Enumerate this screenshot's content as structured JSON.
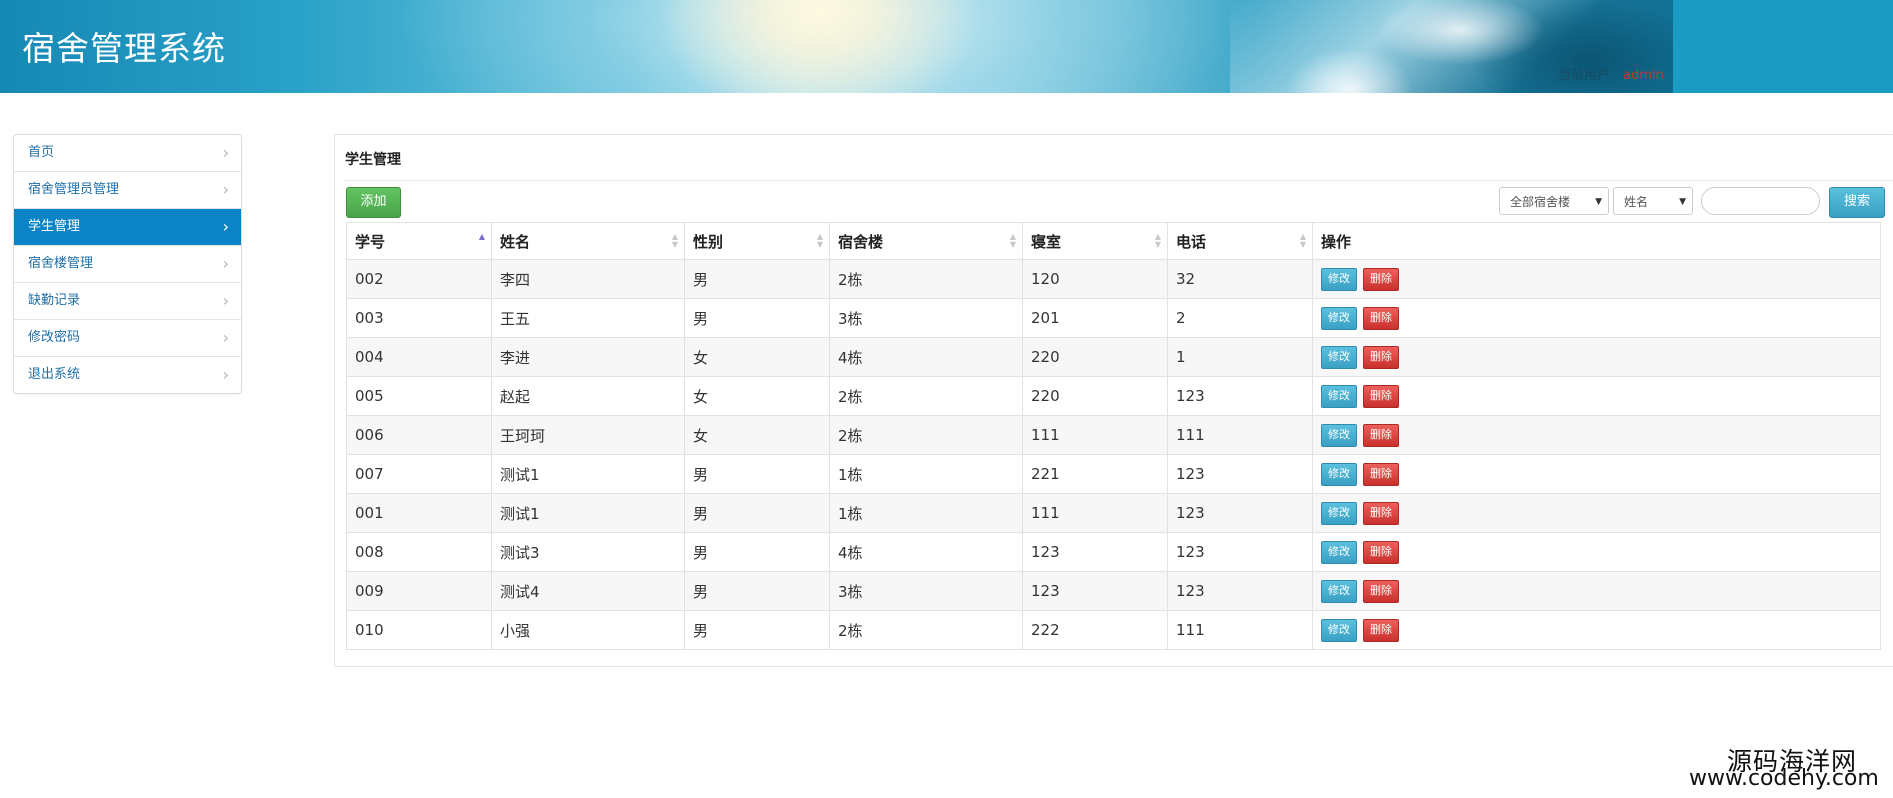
{
  "header": {
    "title": "宿舍管理系统",
    "current_user_label": "当前用户：",
    "current_user_name": "admin"
  },
  "sidebar": {
    "items": [
      {
        "label": "首页",
        "active": false
      },
      {
        "label": "宿舍管理员管理",
        "active": false
      },
      {
        "label": "学生管理",
        "active": true
      },
      {
        "label": "宿舍楼管理",
        "active": false
      },
      {
        "label": "缺勤记录",
        "active": false
      },
      {
        "label": "修改密码",
        "active": false
      },
      {
        "label": "退出系统",
        "active": false
      }
    ]
  },
  "main": {
    "title": "学生管理",
    "add_button": "添加",
    "building_select": "全部宿舍楼",
    "field_select": "姓名",
    "search_value": "",
    "search_button": "搜索",
    "table": {
      "columns": [
        "学号",
        "姓名",
        "性别",
        "宿舍楼",
        "寝室",
        "电话",
        "操作"
      ],
      "sort_column": "学号",
      "sort_direction": "asc",
      "rows": [
        [
          "002",
          "李四",
          "男",
          "2栋",
          "120",
          "32"
        ],
        [
          "003",
          "王五",
          "男",
          "3栋",
          "201",
          "2"
        ],
        [
          "004",
          "李进",
          "女",
          "4栋",
          "220",
          "1"
        ],
        [
          "005",
          "赵起",
          "女",
          "2栋",
          "220",
          "123"
        ],
        [
          "006",
          "王珂珂",
          "女",
          "2栋",
          "111",
          "111"
        ],
        [
          "007",
          "测试1",
          "男",
          "1栋",
          "221",
          "123"
        ],
        [
          "001",
          "测试1",
          "男",
          "1栋",
          "111",
          "123"
        ],
        [
          "008",
          "测试3",
          "男",
          "4栋",
          "123",
          "123"
        ],
        [
          "009",
          "测试4",
          "男",
          "3栋",
          "123",
          "123"
        ],
        [
          "010",
          "小强",
          "男",
          "2栋",
          "222",
          "111"
        ]
      ],
      "edit_label": "修改",
      "delete_label": "删除"
    }
  },
  "watermark": {
    "line1": "源码海洋网",
    "line2": "www.codehy.com"
  },
  "colors": {
    "active_nav": "#0a84c6",
    "add_button": "#5cb85c",
    "edit_button": "#5bc0de",
    "delete_button": "#d9534f",
    "header": "#1a9bc4"
  }
}
